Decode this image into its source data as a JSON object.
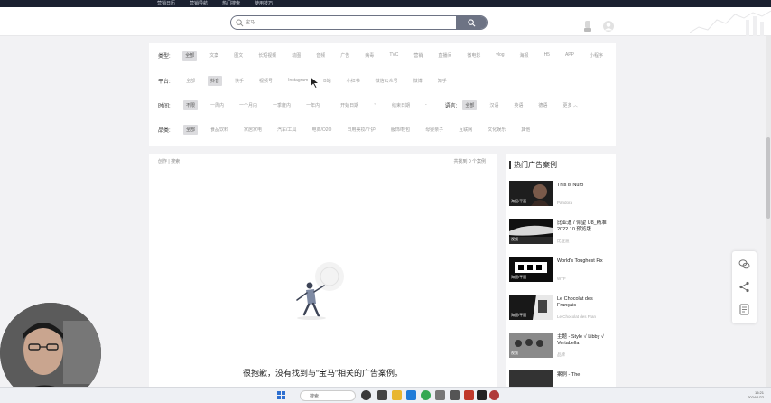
{
  "topbar": {
    "links": [
      "营销日历",
      "营销导航",
      "热门搜索",
      "使用技巧"
    ]
  },
  "search": {
    "placeholder": "宝马",
    "button_icon": "search-icon"
  },
  "filters": {
    "type": {
      "label": "类型:",
      "options": [
        "全部",
        "文案",
        "图文",
        "长短视频",
        "动图",
        "音频",
        "广告",
        "病毒",
        "TVC",
        "营销",
        "直播间",
        "微电影",
        "vlog",
        "海报",
        "H5",
        "APP",
        "小程序"
      ],
      "selected": 0
    },
    "platform": {
      "label": "平台:",
      "options": [
        "全部",
        "抖音",
        "快手",
        "视频号",
        "Instagram",
        "B站",
        "小红书",
        "微信公众号",
        "微博",
        "知乎"
      ],
      "selected": 1
    },
    "time": {
      "label": "时间:",
      "options": [
        "不限",
        "一周内",
        "一个月内",
        "一季度内",
        "一年内",
        "开始日期",
        "~",
        "结束日期",
        "-"
      ],
      "selected": 0
    },
    "language": {
      "label": "语言:",
      "options": [
        "全部",
        "汉语",
        "英语",
        "德语",
        "更多 ︿"
      ],
      "selected": 0
    },
    "industry": {
      "label": "品类:",
      "options": [
        "全部",
        "食品饮料",
        "家居家电",
        "汽车/工具",
        "电商/O2O",
        "日用美妆/个护",
        "服饰/鞋包",
        "母婴亲子",
        "互联网",
        "文化娱乐",
        "其他"
      ],
      "selected": 0
    }
  },
  "main": {
    "breadcrumb": "创作 | 搜索",
    "count": "共找到 0 个案例",
    "empty_text": "很抱歉，没有找到与“宝马”相关的广告案例。"
  },
  "sidebar": {
    "title": "热门广告案例",
    "items": [
      {
        "title": "This is Nuro",
        "sub": "Pandora",
        "tag": "海报/平面"
      },
      {
        "title": "比亚迪 / 仰望 U8_精准2022 10 预览版",
        "sub": "比亚迪",
        "tag": "视频"
      },
      {
        "title": "World's Toughest Fix",
        "sub": "WTF",
        "tag": "海报/平面"
      },
      {
        "title": "Le Chocolat des Français",
        "sub": "Le Chocolat des Fran",
        "tag": "海报/平面"
      },
      {
        "title": "主题 - Style √ Libby √ Vertabella",
        "sub": "品牌",
        "tag": "视频"
      },
      {
        "title": "案例 - The",
        "sub": "",
        "tag": ""
      }
    ]
  },
  "taskbar": {
    "search_label": "搜索",
    "clock_time": "15:21",
    "clock_date": "2024/1/22"
  },
  "colors": {
    "topbar": "#1b2130",
    "accent": "#6d7384",
    "selected_chip": "#dcdcdf"
  }
}
